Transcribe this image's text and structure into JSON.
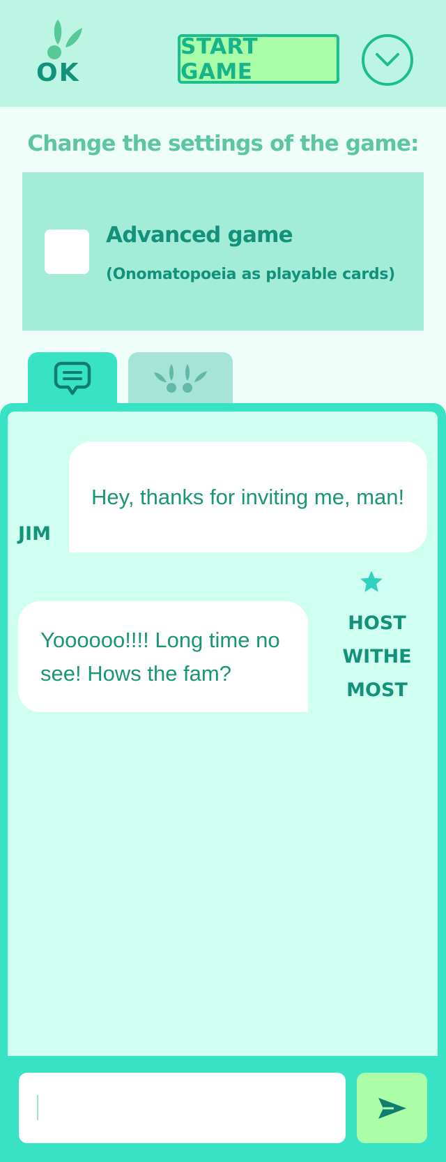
{
  "header": {
    "logo": {
      "text": "OK",
      "icon": "bunny-ears-icon"
    },
    "start_button_label": "START GAME",
    "menu_icon": "chevron-down-icon"
  },
  "settings": {
    "heading": "Change the settings of the game:",
    "options": [
      {
        "label": "Advanced game",
        "sublabel": "(Onomatopoeia as playable cards)",
        "checked": false
      }
    ]
  },
  "tabs": [
    {
      "name": "chat",
      "icon": "chat-bubble-icon",
      "active": true
    },
    {
      "name": "players",
      "icon": "bunny-ears-icon",
      "active": false
    }
  ],
  "chat": {
    "messages": [
      {
        "sender": "JIM",
        "text": "Hey, thanks for inviting me, man!",
        "host": false
      },
      {
        "sender": "HOST WITHE MOST",
        "text": "Yoooooo!!!! Long time no see! Hows the fam?",
        "host": true,
        "badge_icon": "star-icon"
      }
    ],
    "input_value": "",
    "send_icon": "send-arrow-icon"
  },
  "colors": {
    "accent": "#38e2c4",
    "header_bg": "#bcf5e3",
    "button_bg": "#a9fca8",
    "text_dark": "#13917a"
  }
}
